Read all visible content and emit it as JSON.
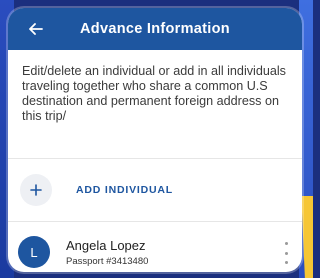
{
  "header": {
    "title": "Advance Information",
    "back_icon": "arrow-left-icon"
  },
  "description": "Edit/delete an individual or add in all individuals traveling together who share a common U.S destination and permanent foreign address on this trip/",
  "add_individual": {
    "label": "ADD INDIVIDUAL",
    "icon": "plus-icon"
  },
  "individuals": [
    {
      "initial": "L",
      "name": "Angela Lopez",
      "passport": "Passport #3413480",
      "menu_icon": "more-vertical-icon"
    }
  ],
  "colors": {
    "primary": "#1e56a0",
    "header_bg": "#1e56a0",
    "accent_yellow": "#f6c635",
    "frame": "#1b2f7e"
  }
}
